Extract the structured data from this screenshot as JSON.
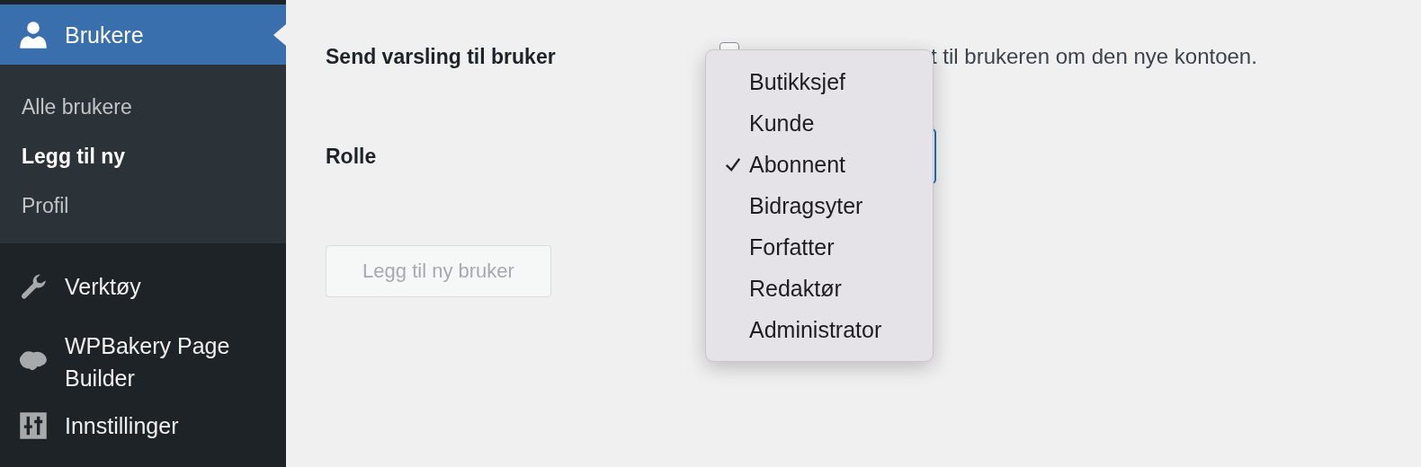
{
  "sidebar": {
    "items": [
      {
        "label": "Brukere",
        "kind": "user",
        "selected": true,
        "children": [
          {
            "label": "Alle brukere",
            "selected": false
          },
          {
            "label": "Legg til ny",
            "selected": true
          },
          {
            "label": "Profil",
            "selected": false
          }
        ]
      },
      {
        "label": "Verktøy",
        "kind": "wrench",
        "selected": false
      },
      {
        "label": "WPBakery Page Builder",
        "kind": "cloud",
        "selected": false
      },
      {
        "label": "Innstillinger",
        "kind": "sliders",
        "selected": false
      }
    ]
  },
  "form": {
    "notify": {
      "label": "Send varsling til bruker",
      "checked": false,
      "text": "t til brukeren om den nye kontoen."
    },
    "role": {
      "label": "Rolle"
    },
    "submit": {
      "label": "Legg til ny bruker",
      "disabled": true
    }
  },
  "dropdown": {
    "options": [
      {
        "label": "Butikksjef",
        "selected": false
      },
      {
        "label": "Kunde",
        "selected": false
      },
      {
        "label": "Abonnent",
        "selected": true
      },
      {
        "label": "Bidragsyter",
        "selected": false
      },
      {
        "label": "Forfatter",
        "selected": false
      },
      {
        "label": "Redaktør",
        "selected": false
      },
      {
        "label": "Administrator",
        "selected": false
      }
    ]
  }
}
